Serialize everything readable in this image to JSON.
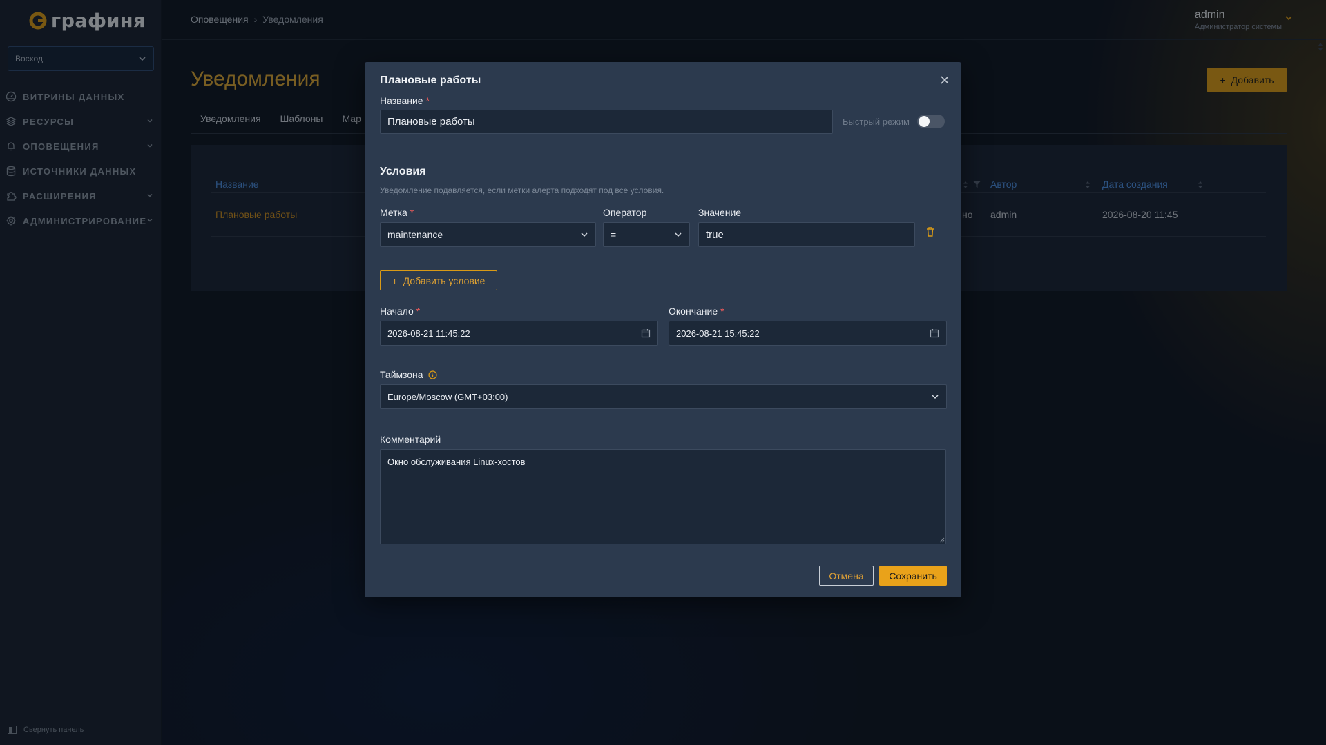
{
  "app": {
    "logo_text": "графиня",
    "org": "Восход",
    "collapse_label": "Свернуть панель",
    "accent": "#d99a16",
    "link_color": "#4d8ee0"
  },
  "sidebar": {
    "items": [
      {
        "label": "Витрины данных",
        "icon": "dashboard-icon",
        "chevron": false
      },
      {
        "label": "Ресурсы",
        "icon": "layers-icon",
        "chevron": true
      },
      {
        "label": "Оповещения",
        "icon": "bell-icon",
        "chevron": true
      },
      {
        "label": "Источники данных",
        "icon": "database-icon",
        "chevron": false
      },
      {
        "label": "Расширения",
        "icon": "puzzle-icon",
        "chevron": true
      },
      {
        "label": "Администрирование",
        "icon": "gear-icon",
        "chevron": true
      }
    ]
  },
  "header": {
    "breadcrumb": [
      "Оповещения",
      "Уведомления"
    ],
    "user_name": "admin",
    "user_role": "Администратор системы"
  },
  "page": {
    "title": "Уведомления",
    "add_label": "Добавить",
    "tabs": [
      "Уведомления",
      "Шаблоны",
      "Мар"
    ]
  },
  "table": {
    "headers": {
      "name": "Название",
      "author": "Автор",
      "created": "Дата создания"
    },
    "rows": [
      {
        "name": "Плановые работы",
        "partial": "но",
        "author": "admin",
        "created": "2026-08-20 11:45"
      }
    ]
  },
  "modal": {
    "title": "Плановые работы",
    "name_label": "Название",
    "name_value": "Плановые работы",
    "fast_mode_label": "Быстрый режим",
    "conditions_title": "Условия",
    "conditions_desc": "Уведомление подавляется, если метки алерта подходят под все условия.",
    "label_label": "Метка",
    "operator_label": "Оператор",
    "value_label": "Значение",
    "label_value": "maintenance",
    "operator_value": "=",
    "value_value": "true",
    "add_condition_label": "Добавить условие",
    "start_label": "Начало",
    "start_value": "2026-08-21 11:45:22",
    "end_label": "Окончание",
    "end_value": "2026-08-21 15:45:22",
    "timezone_label": "Таймзона",
    "timezone_value": "Europe/Moscow (GMT+03:00)",
    "comment_label": "Комментарий",
    "comment_value": "Окно обслуживания Linux-хостов",
    "cancel_label": "Отмена",
    "save_label": "Сохранить"
  }
}
